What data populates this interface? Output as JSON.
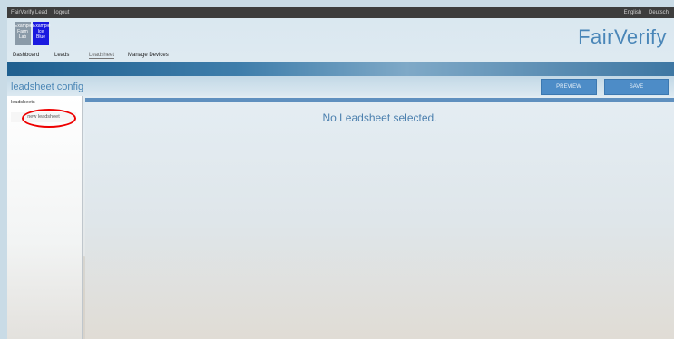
{
  "topbar": {
    "left_items": [
      "FairVerify Lead",
      "logout"
    ],
    "right_items": [
      "English",
      "Deutsch"
    ]
  },
  "brand": {
    "name": "FairVerify"
  },
  "tiles": [
    {
      "label": "Example Farm Lab",
      "color": "#8a9aa8"
    },
    {
      "label": "Example Ice Blue",
      "color": "#1a1ae0"
    }
  ],
  "nav": {
    "tabs": [
      "Dashboard",
      "Leads",
      "Leadsheet",
      "Manage Devices"
    ],
    "active": "Leadsheet"
  },
  "page": {
    "title": "leadsheet config"
  },
  "actions": {
    "preview_label": "PREVIEW",
    "save_label": "SAVE"
  },
  "sidebar": {
    "title": "leadsheets",
    "new_button_label": "new leadsheet"
  },
  "main": {
    "message": "No Leadsheet selected."
  }
}
